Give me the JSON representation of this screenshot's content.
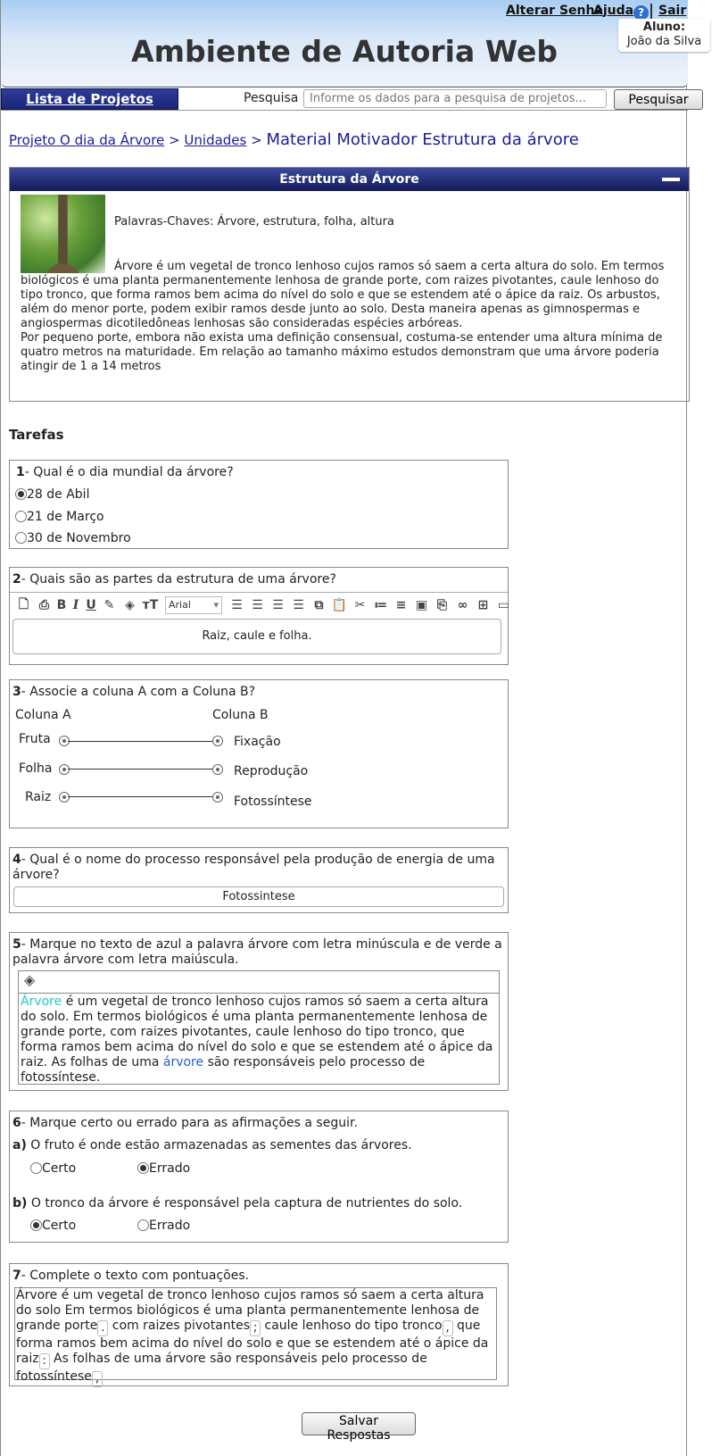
{
  "header": {
    "title": "Ambiente de Autoria Web",
    "change_password": "Alterar Senha",
    "help": "Ajuda",
    "help_icon": "?",
    "logout": "Sair",
    "user_label": "Aluno:",
    "user_name": "João da Silva"
  },
  "nav": {
    "projects_tab": "Lista de Projetos",
    "search_label": "Pesquisa",
    "search_placeholder": "Informe os dados para a pesquisa de projetos...",
    "search_button": "Pesquisar"
  },
  "breadcrumb": {
    "project": "Projeto O dia da Árvore",
    "sep1": ">",
    "units": "Unidades",
    "sep2": ">",
    "current": "Material Motivador Estrutura da árvore"
  },
  "material": {
    "title": "Estrutura da Árvore",
    "keywords": "Palavras-Chaves: Árvore, estrutura, folha, altura",
    "text": "Árvore é um vegetal de tronco lenhoso cujos ramos só saem a certa altura do solo.   Em termos biológicos é uma planta permanentemente lenhosa de grande porte, com raizes pivotantes, caule lenhoso do tipo tronco, que forma ramos bem acima do nível do solo e que se estendem até o ápice da raiz. Os arbustos, além do menor porte, podem exibir ramos desde junto ao solo. Desta maneira apenas as gimnospermas e angiospermas dicotiledôneas lenhosas são consideradas espécies arbóreas.",
    "text2": "Por pequeno porte, embora não exista uma definição consensual, costuma-se entender uma altura mínima de quatro metros na maturidade. Em relação ao tamanho máximo estudos demonstram que uma árvore poderia atingir de 1 a 14 metros"
  },
  "tasks_title": "Tarefas",
  "q1": {
    "num": "1",
    "text": "- Qual é o dia mundial da árvore?",
    "options": [
      "28 de Abil",
      "21 de Março",
      "30 de Novembro"
    ],
    "selected": 0
  },
  "q2": {
    "num": "2",
    "text": "- Quais são as partes  da estrutura de uma árvore?",
    "font": "Arial",
    "answer": "Raiz, caule e folha."
  },
  "q3": {
    "num": "3",
    "text": "- Associe a coluna A com a Coluna B?",
    "col_a": "Coluna A",
    "col_b": "Coluna B",
    "left": [
      "Fruta",
      "Folha",
      "Raiz"
    ],
    "right": [
      "Fixação",
      "Reprodução",
      "Fotossíntese"
    ]
  },
  "q4": {
    "num": "4",
    "text": "-  Qual é o nome do processo responsável pela produção de energia de uma árvore?",
    "answer": "Fotossintese"
  },
  "q5": {
    "num": "5",
    "text": "- Marque no texto de azul a palavra árvore com letra minúscula e de verde a palavra árvore com letra maiúscula.",
    "word1": "Árvore",
    "part1": " é um vegetal de tronco lenhoso cujos ramos só saem a certa altura do solo. Em termos biológicos é uma planta permanentemente lenhosa de grande porte, com raizes pivotantes, caule lenhoso do tipo tronco, que forma ramos bem acima do nível do solo e que se estendem até o ápice da raiz. As folhas de uma ",
    "word2": "árvore",
    "part2": " são responsáveis pelo processo de fotossíntese.",
    "color_upper": "#23c8c8",
    "color_lower": "#1e5fd0"
  },
  "q6": {
    "num": "6",
    "text": "- Marque certo ou errado para as afirmações a seguir.",
    "a_label": "a)",
    "a_text": " O fruto é onde estão armazenadas as sementes das árvores.",
    "b_label": "b)",
    "b_text": " O tronco da árvore é responsável pela captura de nutrientes do solo.",
    "certo": "Certo",
    "errado": "Errado",
    "a_selected": "Errado",
    "b_selected": "Certo"
  },
  "q7": {
    "num": "7",
    "text": "- Complete o texto com pontuações.",
    "t1": "Árvore é um vegetal de tronco lenhoso cujos ramos só saem a certa altura do solo Em termos biológicos é uma planta permanentemente lenhosa de grande porte",
    "p1": ".",
    "t2": "  com raizes pivotantes",
    "p2": ";",
    "t3": "  caule lenhoso do tipo tronco",
    "p3": ",",
    "t4": " que forma ramos bem acima do nível do solo e que se estendem até o ápice da raiz",
    "p4": ":",
    "t5": "   As folhas de uma árvore são responsáveis pelo processo de fotossíntese",
    "p5": ","
  },
  "save_button": "Salvar Respostas"
}
